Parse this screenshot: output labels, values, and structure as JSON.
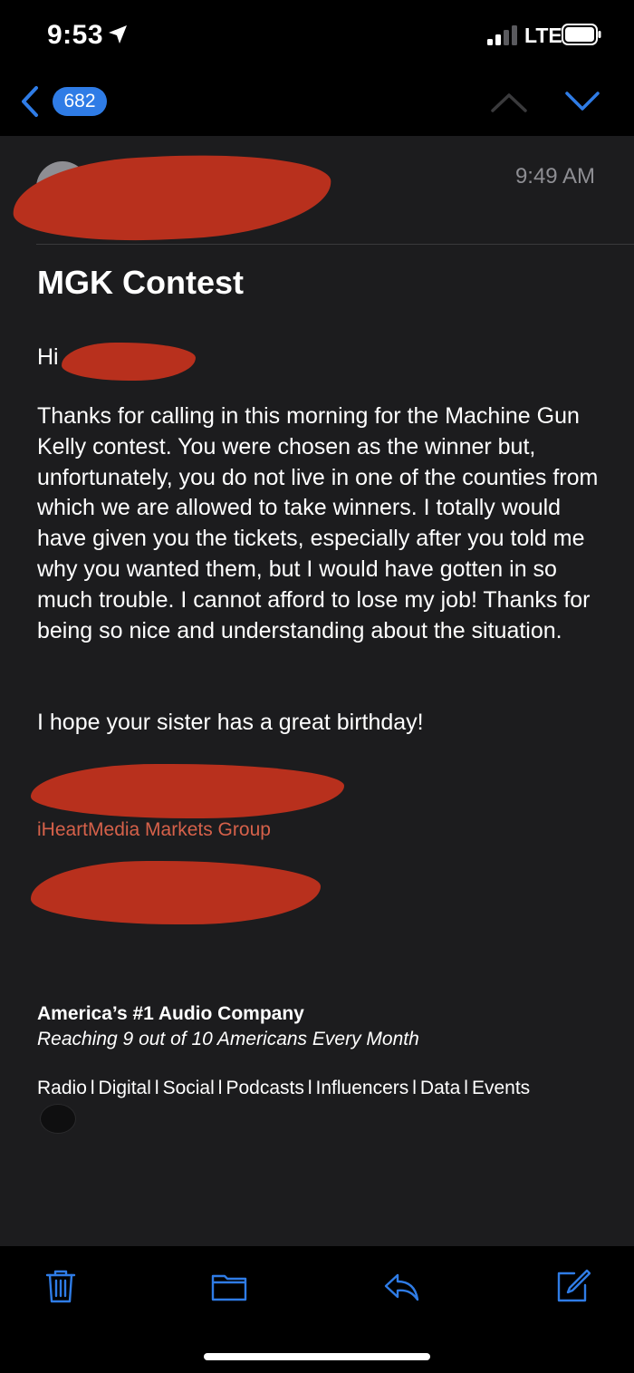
{
  "status_bar": {
    "time": "9:53",
    "network": "LTE"
  },
  "nav": {
    "message_count": "682"
  },
  "mail": {
    "received_time": "9:49 AM",
    "subject": "MGK Contest",
    "greeting": "Hi",
    "paragraph_1": "Thanks for calling in this morning for the Machine Gun Kelly contest.  You were chosen as the winner but, unfortunately, you do not live in one of the counties from which we are allowed to take winners.  I totally would have given you the tickets, especially after you told me why you wanted them, but I would have gotten in so much trouble.  I cannot afford to lose my job!  Thanks for being so nice and understanding about the situation.",
    "paragraph_2": "I hope your sister has a great birthday!",
    "signature_company": "iHeartMedia Markets Group",
    "tagline": "America’s #1 Audio Company",
    "subtagline": "Reaching 9 out of 10 Americans Every Month",
    "links": [
      "Radio",
      "Digital",
      "Social",
      "Podcasts",
      "Influencers",
      "Data",
      "Events"
    ],
    "link_separator": "l"
  },
  "toolbar": {
    "icons": [
      "trash-icon",
      "folder-icon",
      "reply-icon",
      "compose-icon"
    ]
  },
  "colors": {
    "accent": "#2f7ce6",
    "redaction": "#b8301d",
    "signature_link": "#d6614a",
    "mail_background": "#1c1c1e"
  }
}
